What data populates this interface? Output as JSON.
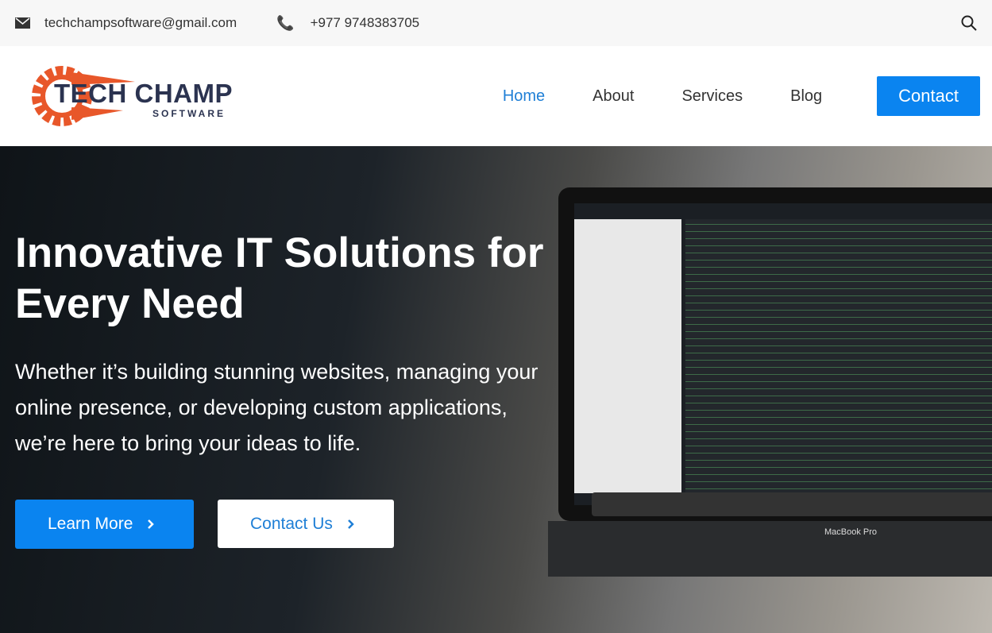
{
  "topbar": {
    "email": "techchampsoftware@gmail.com",
    "phone": "+977 9748383705"
  },
  "logo": {
    "name": "TECH CHAMP",
    "sub": "SOFTWARE"
  },
  "nav": {
    "items": [
      "Home",
      "About",
      "Services",
      "Blog"
    ],
    "contact": "Contact"
  },
  "hero": {
    "title": "Innovative IT Solutions for Every Need",
    "text": "Whether it’s building stunning websites, managing your online presence, or developing custom applications, we’re here to bring your ideas to life.",
    "learn_more": "Learn More",
    "contact_us": "Contact Us",
    "laptop_label": "MacBook Pro"
  },
  "colors": {
    "accent": "#0a84f0",
    "logo_orange": "#e8572a",
    "logo_navy": "#2b3350"
  }
}
